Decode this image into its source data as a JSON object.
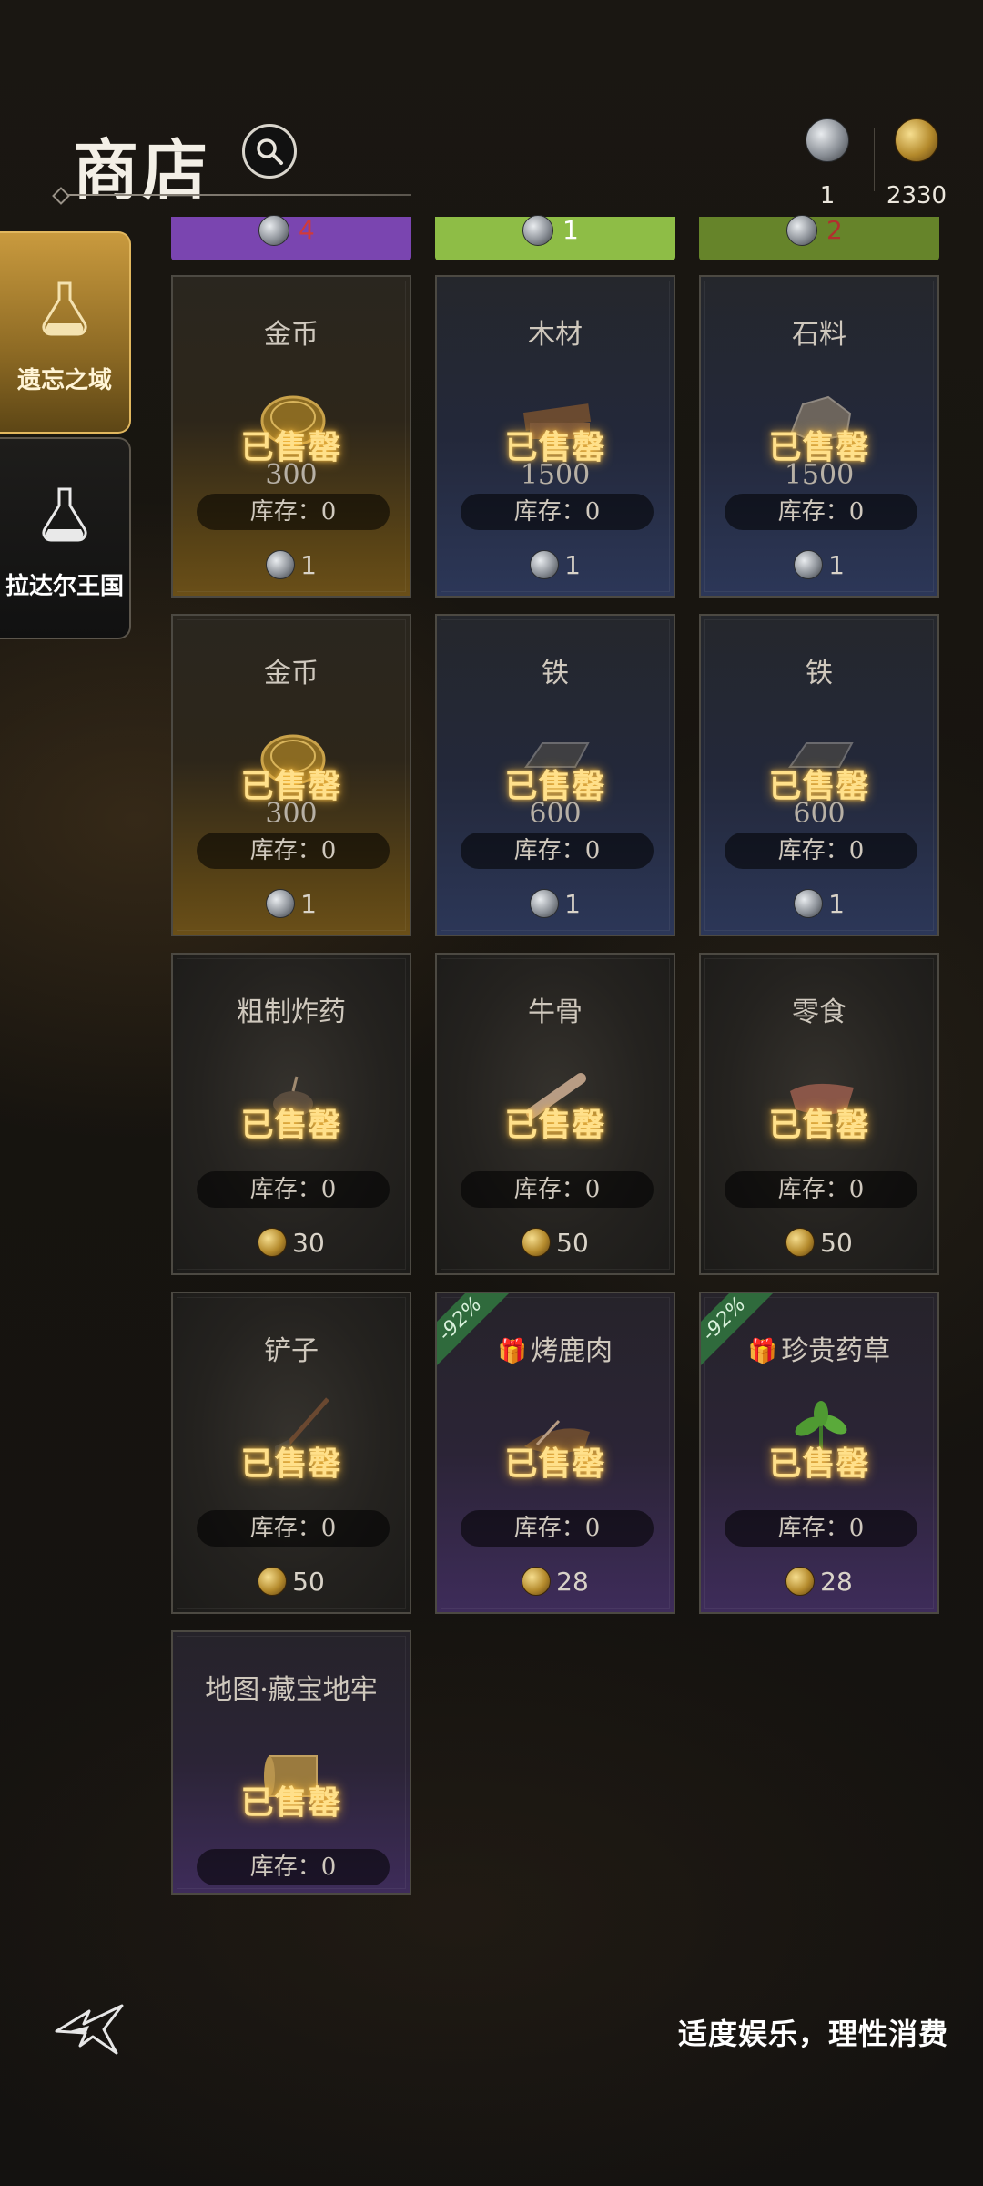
{
  "header": {
    "title": "商店"
  },
  "currency": [
    {
      "icon": "silver-coin-icon",
      "value": "1"
    },
    {
      "icon": "gold-coin-icon",
      "value": "2330"
    }
  ],
  "tabs": [
    {
      "label": "遗忘之域",
      "active": true
    },
    {
      "label": "拉达尔王国",
      "active": false
    }
  ],
  "top_strip": [
    {
      "value": "4",
      "color": "#8a4fc2"
    },
    {
      "value": "1",
      "color": "#8ebd46"
    },
    {
      "value": "2",
      "color": "#6d8a2a"
    }
  ],
  "labels": {
    "sold": "已售罄"
  },
  "items": [
    {
      "name": "金币",
      "icon": "gold-coins-icon",
      "qty": "300",
      "stock": "库存：0",
      "price": "1",
      "currency": "silver",
      "rarity": "gold"
    },
    {
      "name": "木材",
      "icon": "wood-planks-icon",
      "qty": "1500",
      "stock": "库存：0",
      "price": "1",
      "currency": "silver",
      "rarity": "blue"
    },
    {
      "name": "石料",
      "icon": "stone-icon",
      "qty": "1500",
      "stock": "库存：0",
      "price": "1",
      "currency": "silver",
      "rarity": "blue"
    },
    {
      "name": "金币",
      "icon": "gold-coins-icon",
      "qty": "300",
      "stock": "库存：0",
      "price": "1",
      "currency": "silver",
      "rarity": "gold"
    },
    {
      "name": "铁",
      "icon": "iron-ingot-icon",
      "qty": "600",
      "stock": "库存：0",
      "price": "1",
      "currency": "silver",
      "rarity": "blue"
    },
    {
      "name": "铁",
      "icon": "iron-ingot-icon",
      "qty": "600",
      "stock": "库存：0",
      "price": "1",
      "currency": "silver",
      "rarity": "blue"
    },
    {
      "name": "粗制炸药",
      "icon": "bomb-icon",
      "qty": "",
      "stock": "库存：0",
      "price": "30",
      "currency": "gold",
      "rarity": "plain"
    },
    {
      "name": "牛骨",
      "icon": "bone-icon",
      "qty": "",
      "stock": "库存：0",
      "price": "50",
      "currency": "gold",
      "rarity": "plain"
    },
    {
      "name": "零食",
      "icon": "jerky-icon",
      "qty": "",
      "stock": "库存：0",
      "price": "50",
      "currency": "gold",
      "rarity": "plain"
    },
    {
      "name": "铲子",
      "icon": "shovel-icon",
      "qty": "",
      "stock": "库存：0",
      "price": "50",
      "currency": "gold",
      "rarity": "plain"
    },
    {
      "name": "烤鹿肉",
      "icon": "roast-meat-icon",
      "qty": "",
      "stock": "库存：0",
      "price": "28",
      "currency": "gold",
      "rarity": "purple",
      "discount": "-92%",
      "gift": true
    },
    {
      "name": "珍贵药草",
      "icon": "herb-icon",
      "qty": "",
      "stock": "库存：0",
      "price": "28",
      "currency": "gold",
      "rarity": "purple",
      "discount": "-92%",
      "gift": true
    },
    {
      "name": "地图·藏宝地牢",
      "icon": "map-scroll-icon",
      "qty": "",
      "stock": "库存：0",
      "price": "",
      "currency": "",
      "rarity": "purple"
    }
  ],
  "footer": {
    "text": "适度娱乐，理性消费"
  }
}
